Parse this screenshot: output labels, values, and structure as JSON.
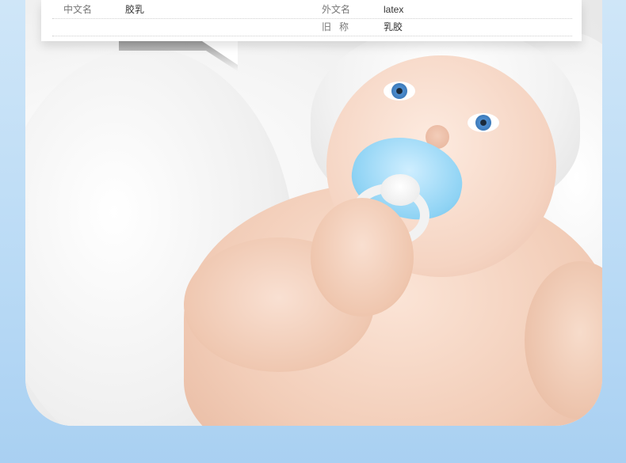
{
  "info_table": {
    "rows": [
      {
        "left_label": "中文名",
        "left_value": "胶乳",
        "right_label": "外文名",
        "right_value": "latex"
      },
      {
        "left_label": "",
        "left_value": "",
        "right_label": "旧   称",
        "right_value": "乳胶"
      }
    ]
  },
  "colors": {
    "page_background": "#b9daf5",
    "card_background": "#ffffff",
    "label_text": "#777777",
    "value_text": "#333333",
    "pacifier_blue": "#8fd3f4"
  }
}
